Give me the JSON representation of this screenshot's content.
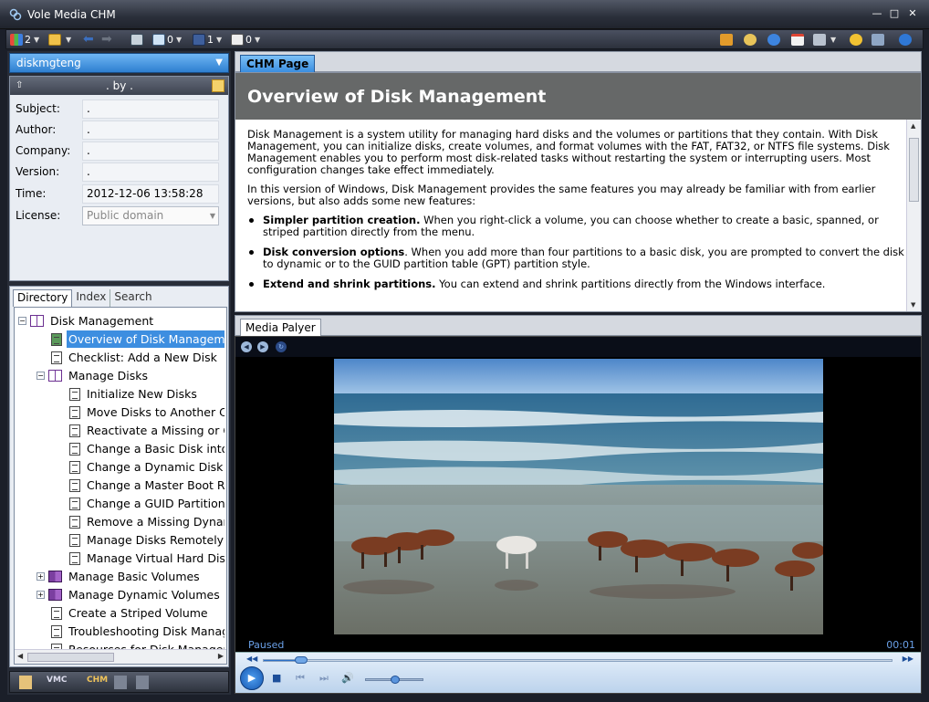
{
  "window": {
    "title": "Vole Media CHM"
  },
  "toolbar": {
    "item1_count": "2",
    "item2_count": "0",
    "item3_count": "1",
    "item4_count": "0"
  },
  "left_panel": {
    "header": "diskmgteng",
    "info": {
      "by_line": ". by .",
      "fields": [
        {
          "label": "Subject:",
          "value": "."
        },
        {
          "label": "Author:",
          "value": "."
        },
        {
          "label": "Company:",
          "value": "."
        },
        {
          "label": "Version:",
          "value": "."
        },
        {
          "label": "Time:",
          "value": "2012-12-06 13:58:28"
        },
        {
          "label": "License:",
          "value": "Public domain"
        }
      ]
    },
    "tabs": [
      "Directory",
      "Index",
      "Search"
    ],
    "tree": [
      {
        "label": "Disk Management"
      },
      {
        "label": "Overview of Disk Management"
      },
      {
        "label": "Checklist: Add a New Disk"
      },
      {
        "label": "Manage Disks"
      },
      {
        "label": "Initialize New Disks"
      },
      {
        "label": "Move Disks to Another Computer"
      },
      {
        "label": "Reactivate a Missing or Offline Disk"
      },
      {
        "label": "Change a Basic Disk into a Dynamic Disk"
      },
      {
        "label": "Change a Dynamic Disk Back to a Basic Disk"
      },
      {
        "label": "Change a Master Boot Record Disk"
      },
      {
        "label": "Change a GUID Partition Table Disk"
      },
      {
        "label": "Remove a Missing Dynamic Disk"
      },
      {
        "label": "Manage Disks Remotely"
      },
      {
        "label": "Manage Virtual Hard Disks"
      },
      {
        "label": "Manage Basic Volumes"
      },
      {
        "label": "Manage Dynamic Volumes"
      },
      {
        "label": "Create a Striped Volume"
      },
      {
        "label": "Troubleshooting Disk Management"
      },
      {
        "label": "Resources for Disk Management"
      }
    ],
    "bottom": {
      "vmc": "VMC",
      "chm": "CHM"
    }
  },
  "chm": {
    "tab": "CHM Page",
    "title": "Overview of Disk Management",
    "para1": "Disk Management is a system utility for managing hard disks and the volumes or partitions that they contain. With Disk Management, you can initialize disks, create volumes, and format volumes with the FAT, FAT32, or NTFS file systems. Disk Management enables you to perform most disk-related tasks without restarting the system or interrupting users. Most configuration changes take effect immediately.",
    "para2": "In this version of Windows, Disk Management provides the same features you may already be familiar with from earlier versions, but also adds some new features:",
    "bullets": [
      {
        "bold": "Simpler partition creation.",
        "text": " When you right-click a volume, you can choose whether to create a basic, spanned, or striped partition directly from the menu."
      },
      {
        "bold": "Disk conversion options",
        "text": ". When you add more than four partitions to a basic disk, you are prompted to convert the disk to dynamic or to the GUID partition table (GPT) partition style."
      },
      {
        "bold": "Extend and shrink partitions.",
        "text": " You can extend and shrink partitions directly from the Windows interface."
      }
    ]
  },
  "media": {
    "tab": "Media Palyer",
    "status": "Paused",
    "time": "00:01",
    "seek_fraction": 0.06,
    "volume_fraction": 0.5
  }
}
